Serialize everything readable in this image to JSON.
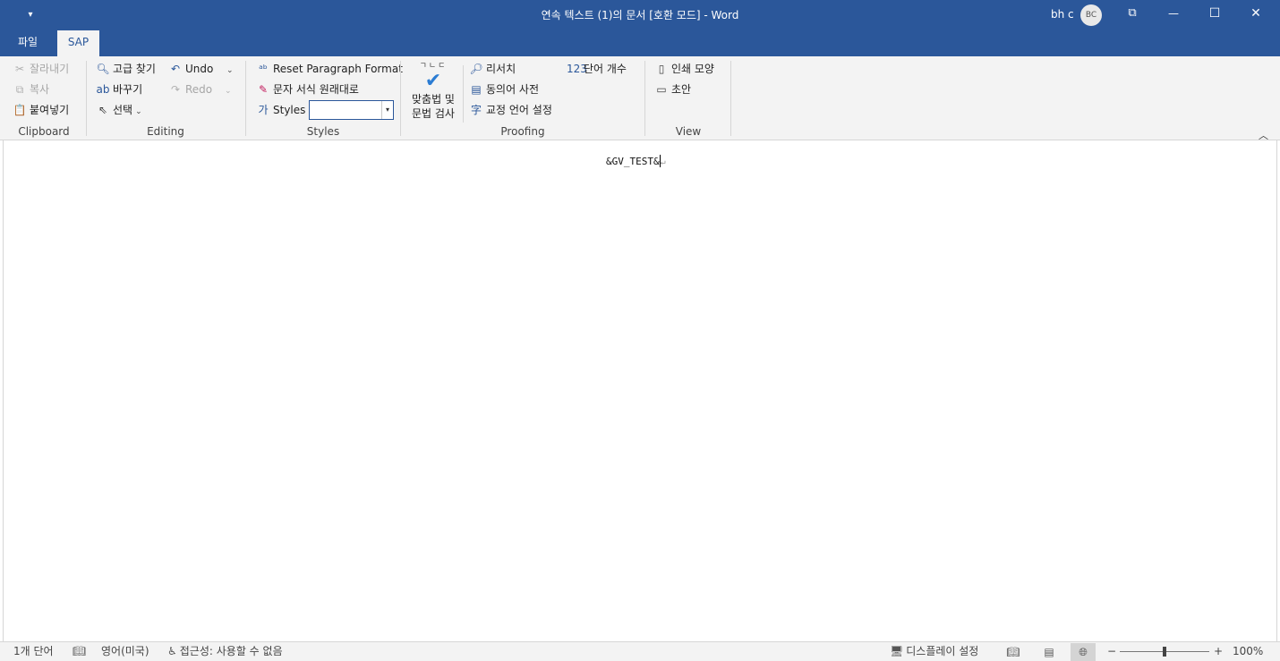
{
  "window": {
    "title": "연속 텍스트 (1)의 문서 [호환 모드]  -  Word",
    "user_name": "bh c",
    "avatar_initials": "BC",
    "qat_glyph": "▾",
    "restore_glyph": "⧉",
    "minimize_glyph": "—",
    "maximize_glyph": "☐",
    "close_glyph": "✕"
  },
  "tabs": [
    {
      "label": "파일",
      "active": false
    },
    {
      "label": "SAP",
      "active": true
    }
  ],
  "ribbon": {
    "clipboard": {
      "label": "Clipboard",
      "cut": "잘라내기",
      "copy": "복사",
      "paste": "붙여넣기"
    },
    "editing": {
      "label": "Editing",
      "advanced_find": "고급 찾기",
      "replace": "바꾸기",
      "select": "선택",
      "undo": "Undo",
      "redo": "Redo"
    },
    "styles": {
      "label": "Styles",
      "reset_paragraph": "Reset Paragraph Format",
      "clear_formatting": "문자 서식 원래대로",
      "styles_label": "Styles",
      "styles_value": ""
    },
    "proofing": {
      "label": "Proofing",
      "spell_abc": "ㄱㄴㄷ",
      "spell_line1": "맞춤법 및",
      "spell_line2": "문법 검사",
      "research": "리서치",
      "thesaurus": "동의어 사전",
      "language": "교정 언어 설정",
      "word_count": "단어 개수"
    },
    "view": {
      "label": "View",
      "print_layout": "인쇄 모양",
      "draft": "초안"
    },
    "collapse_glyph": "︿"
  },
  "document": {
    "text": "&GV_TEST&",
    "pilcrow": "↵"
  },
  "status": {
    "word_count": "1개 단어",
    "language": "영어(미국)",
    "accessibility": "접근성: 사용할 수 없음",
    "display_settings": "디스플레이 설정",
    "zoom_minus": "−",
    "zoom_plus": "+",
    "zoom": "100%",
    "zoom_level_percent": 100
  },
  "colors": {
    "brand": "#2b579a",
    "ribbon": "#f3f3f3"
  }
}
